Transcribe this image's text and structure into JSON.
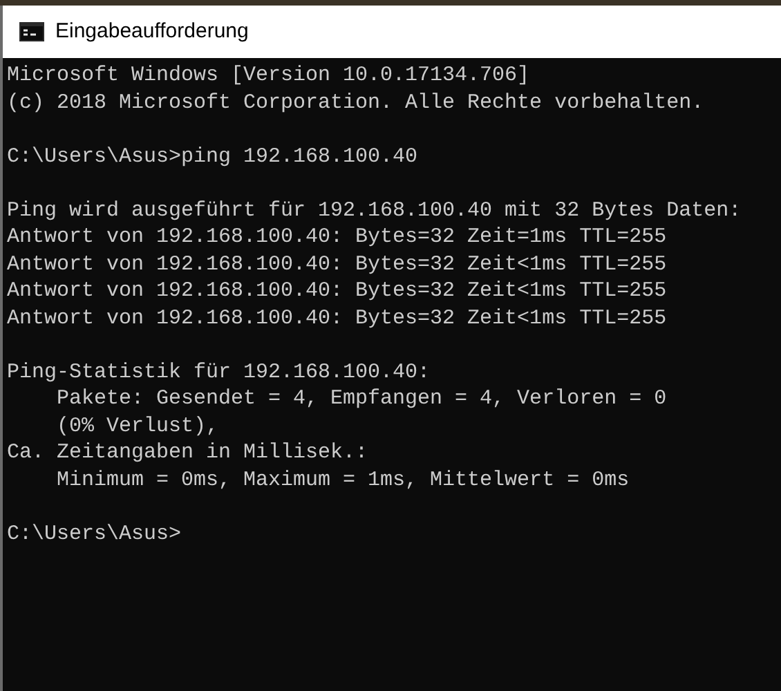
{
  "window": {
    "title": "Eingabeaufforderung"
  },
  "console": {
    "blocks": [
      [
        "Microsoft Windows [Version 10.0.17134.706]",
        "(c) 2018 Microsoft Corporation. Alle Rechte vorbehalten."
      ],
      [
        "C:\\Users\\Asus>ping 192.168.100.40"
      ],
      [
        "Ping wird ausgeführt für 192.168.100.40 mit 32 Bytes Daten:",
        "Antwort von 192.168.100.40: Bytes=32 Zeit=1ms TTL=255",
        "Antwort von 192.168.100.40: Bytes=32 Zeit<1ms TTL=255",
        "Antwort von 192.168.100.40: Bytes=32 Zeit<1ms TTL=255",
        "Antwort von 192.168.100.40: Bytes=32 Zeit<1ms TTL=255"
      ],
      [
        "Ping-Statistik für 192.168.100.40:",
        "    Pakete: Gesendet = 4, Empfangen = 4, Verloren = 0",
        "    (0% Verlust),",
        "Ca. Zeitangaben in Millisek.:",
        "    Minimum = 0ms, Maximum = 1ms, Mittelwert = 0ms"
      ],
      [
        "C:\\Users\\Asus>"
      ]
    ]
  }
}
